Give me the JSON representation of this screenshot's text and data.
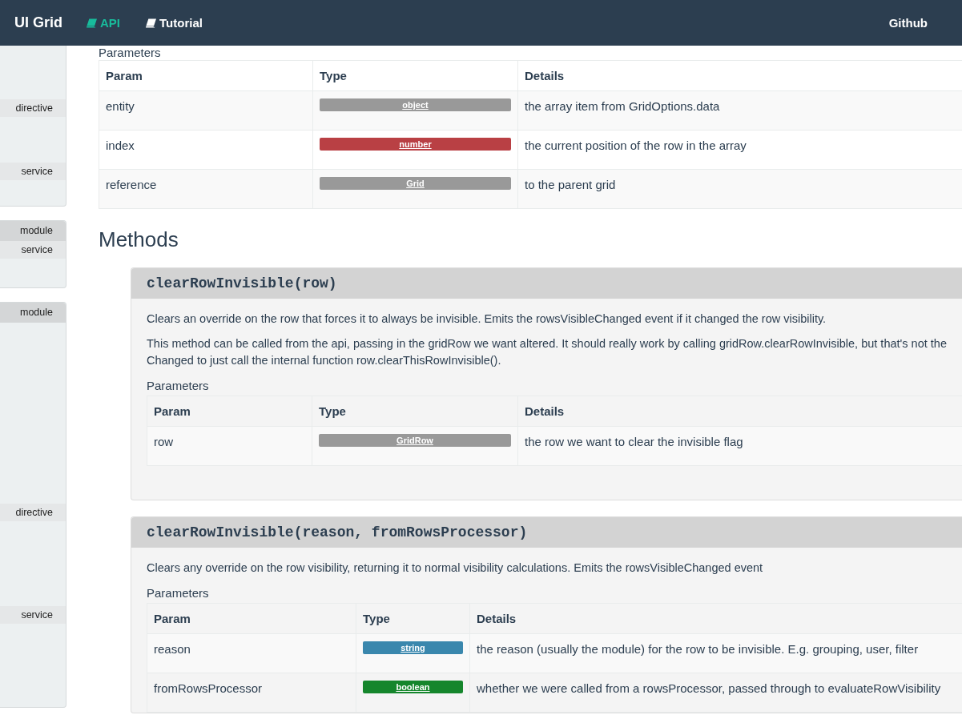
{
  "navbar": {
    "brand": "UI Grid",
    "links": [
      {
        "label": "API",
        "selected": true
      },
      {
        "label": "Tutorial",
        "selected": false
      }
    ],
    "right_link": "Github"
  },
  "sidebar": {
    "panels": [
      {
        "items": [
          "directive",
          "service"
        ]
      },
      {
        "header": "module",
        "items": [
          "service"
        ]
      },
      {
        "header": "module",
        "items": [
          "directive",
          "service"
        ]
      }
    ]
  },
  "parameters": {
    "label": "Parameters",
    "columns": [
      "Param",
      "Type",
      "Details"
    ],
    "rows": [
      {
        "param": "entity",
        "type": {
          "label": "object",
          "color": "#999999"
        },
        "details": "the array item from GridOptions.data"
      },
      {
        "param": "index",
        "type": {
          "label": "number",
          "color": "#b94044"
        },
        "details": "the current position of the row in the array"
      },
      {
        "param": "reference",
        "type": {
          "label": "Grid",
          "color": "#999999"
        },
        "details": "to the parent grid"
      }
    ]
  },
  "methods": {
    "heading": "Methods",
    "items": [
      {
        "signature": "clearRowInvisible(row)",
        "paragraphs": [
          [
            "Clears an override on the row that forces it to always be invisible. Emits the rowsVisibleChanged event if it changed the row visibility."
          ],
          [
            "This method can be called from the api, passing in the gridRow we want altered. It should really work by calling gridRow.clearRowInvisible, but that's not the",
            "Changed to just call the internal function row.clearThisRowInvisible()."
          ]
        ],
        "parameters_label": "Parameters",
        "columns": [
          "Param",
          "Type",
          "Details"
        ],
        "rows": [
          {
            "param": "row",
            "type": {
              "label": "GridRow",
              "color": "#999999"
            },
            "details": "the row we want to clear the invisible flag"
          }
        ]
      },
      {
        "signature": "clearRowInvisible(reason, fromRowsProcessor)",
        "paragraphs": [
          [
            "Clears any override on the row visibility, returning it to normal visibility calculations. Emits the rowsVisibleChanged event"
          ]
        ],
        "parameters_label": "Parameters",
        "columns": [
          "Param",
          "Type",
          "Details"
        ],
        "rows": [
          {
            "param": "reason",
            "type": {
              "label": "string",
              "color": "#3a87ad"
            },
            "details": "the reason (usually the module) for the row to be invisible. E.g. grouping, user, filter"
          },
          {
            "param": "fromRowsProcessor",
            "type": {
              "label": "boolean",
              "color": "#15862c"
            },
            "details": "whether we were called from a rowsProcessor, passed through to evaluateRowVisibility"
          }
        ]
      }
    ]
  }
}
